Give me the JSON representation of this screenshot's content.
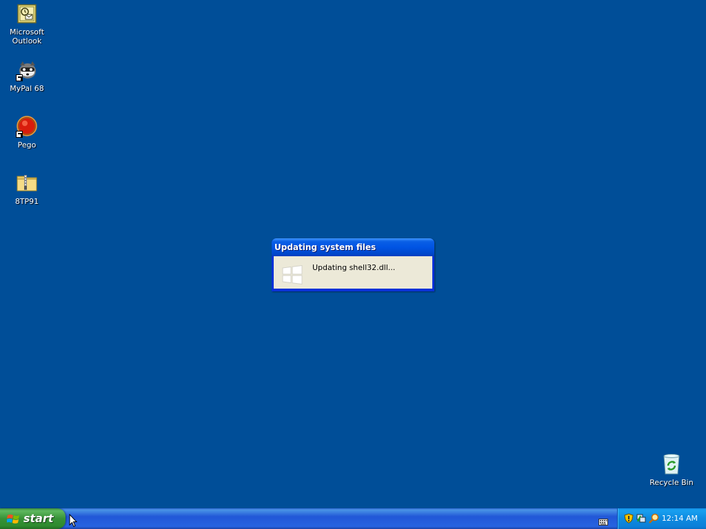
{
  "desktop": {
    "background_color": "#004e98",
    "icons": [
      {
        "label": "Microsoft\nOutlook",
        "icon": "outlook-icon"
      },
      {
        "label": "MyPal 68",
        "icon": "mypal-icon",
        "shortcut": true
      },
      {
        "label": "Pego",
        "icon": "pego-icon",
        "shortcut": true
      },
      {
        "label": "8TP91",
        "icon": "zip-folder-icon"
      },
      {
        "label": "Recycle Bin",
        "icon": "recycle-bin-icon"
      }
    ]
  },
  "dialog": {
    "title": "Updating system files",
    "message": "Updating shell32.dll...",
    "icon": "windows-logo-icon"
  },
  "taskbar": {
    "start_label": "start",
    "clock": "12:14 AM",
    "tray_icons": [
      "security-shield-icon",
      "network-icon",
      "search-icon"
    ],
    "keyboard_icon": "keyboard-icon"
  }
}
